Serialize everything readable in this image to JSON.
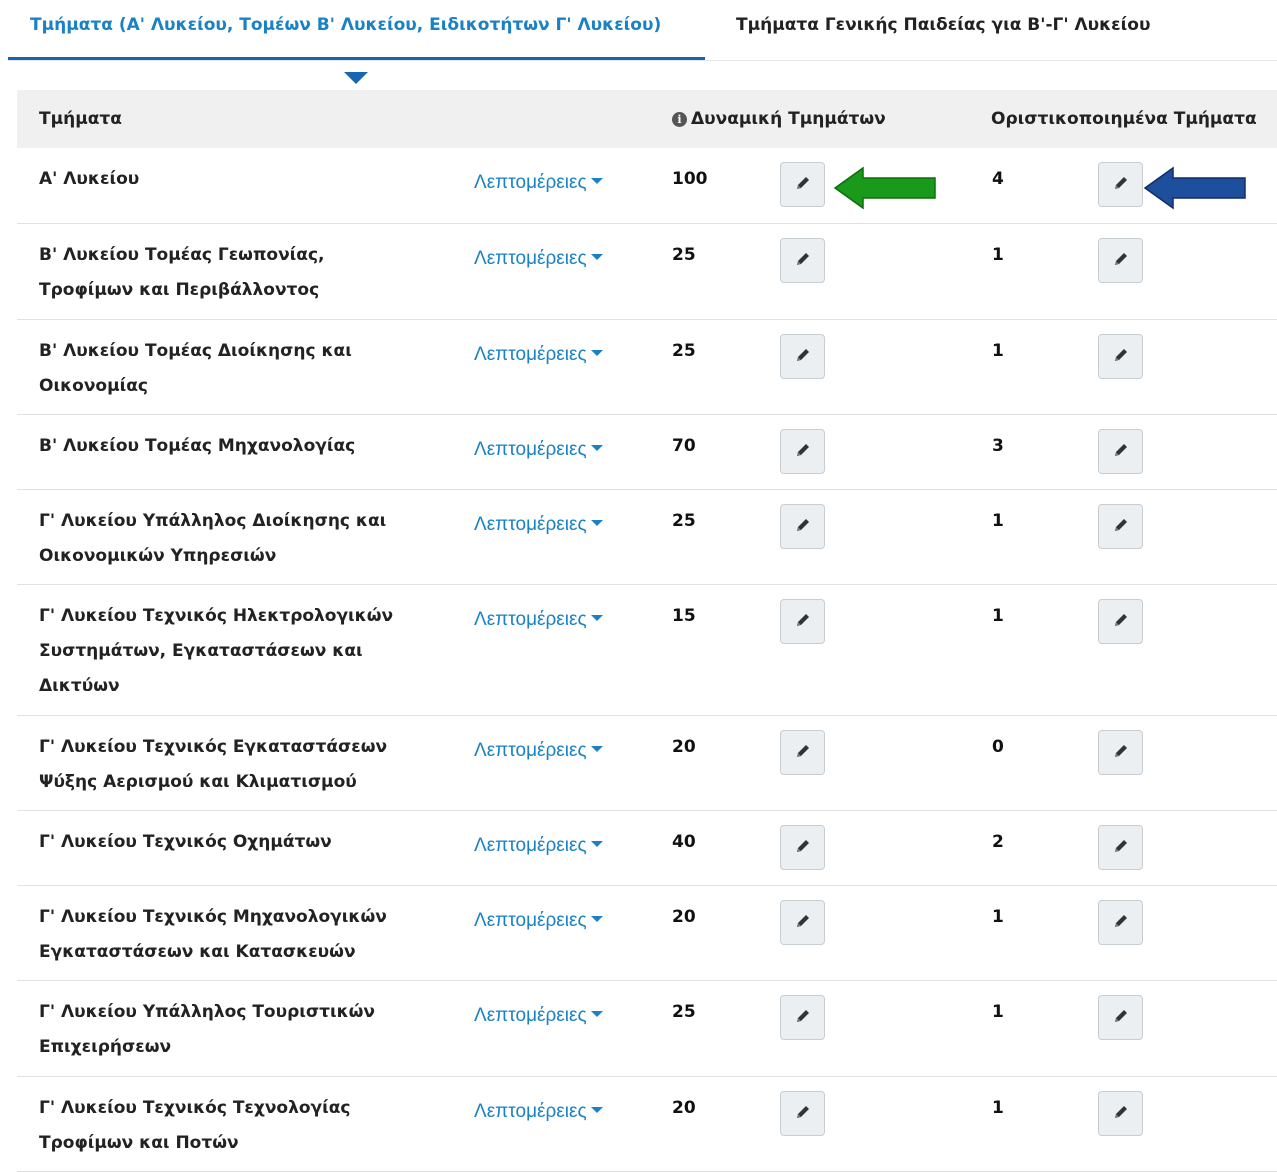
{
  "tabs": [
    {
      "label": "Τμήματα (Α' Λυκείου, Τομέων Β' Λυκείου, Ειδικοτήτων Γ' Λυκείου)",
      "active": true
    },
    {
      "label": "Τμήματα Γενικής Παιδείας για Β'-Γ' Λυκείου",
      "active": false
    }
  ],
  "table": {
    "headers": {
      "sections": "Τμήματα",
      "capacity_icon": "info-icon",
      "capacity": "Δυναμική Τμημάτων",
      "finalized": "Οριστικοποιημένα Τμήματα"
    },
    "details_label": "Λεπτομέρειες",
    "edit_icon": "pencil-icon",
    "rows": [
      {
        "name": "Α' Λυκείου",
        "capacity": "100",
        "finalized": "4"
      },
      {
        "name": "Β' Λυκείου Τομέας Γεωπονίας, Τροφίμων και Περιβάλλοντος",
        "capacity": "25",
        "finalized": "1"
      },
      {
        "name": "Β' Λυκείου Τομέας Διοίκησης και Οικονομίας",
        "capacity": "25",
        "finalized": "1"
      },
      {
        "name": "Β' Λυκείου Τομέας Μηχανολογίας",
        "capacity": "70",
        "finalized": "3"
      },
      {
        "name": "Γ' Λυκείου Υπάλληλος Διοίκησης και Οικονομικών Υπηρεσιών",
        "capacity": "25",
        "finalized": "1"
      },
      {
        "name": "Γ' Λυκείου Τεχνικός Ηλεκτρολογικών Συστημάτων, Εγκαταστάσεων και Δικτύων",
        "capacity": "15",
        "finalized": "1"
      },
      {
        "name": "Γ' Λυκείου Τεχνικός Εγκαταστάσεων Ψύξης Αερισμού και Κλιματισμού",
        "capacity": "20",
        "finalized": "0"
      },
      {
        "name": "Γ' Λυκείου Τεχνικός Οχημάτων",
        "capacity": "40",
        "finalized": "2"
      },
      {
        "name": "Γ' Λυκείου Τεχνικός Μηχανολογικών Εγκαταστάσεων και Κατασκευών",
        "capacity": "20",
        "finalized": "1"
      },
      {
        "name": "Γ' Λυκείου Υπάλληλος Τουριστικών Επιχειρήσεων",
        "capacity": "25",
        "finalized": "1"
      },
      {
        "name": "Γ' Λυκείου Τεχνικός Τεχνολογίας Τροφίμων και Ποτών",
        "capacity": "20",
        "finalized": "1"
      }
    ]
  },
  "annotations": {
    "green_arrow_color": "#1a9a1a",
    "blue_arrow_color": "#1e4f9c"
  }
}
